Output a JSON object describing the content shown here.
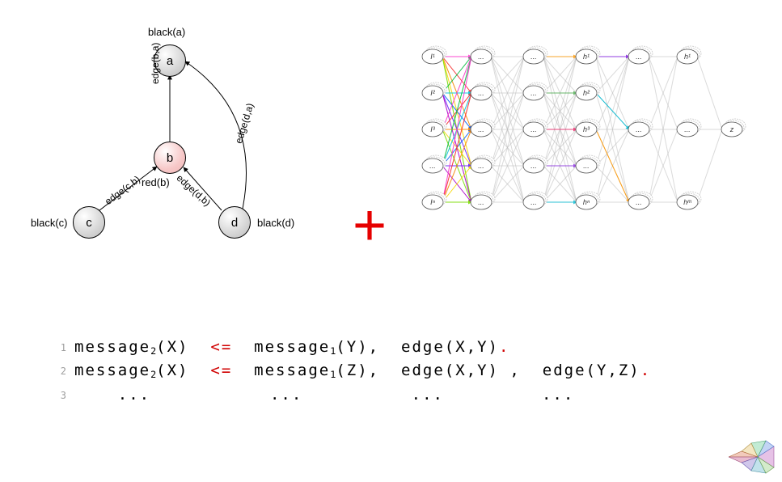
{
  "graph": {
    "nodes": {
      "a": {
        "label": "a",
        "attr": "black(a)"
      },
      "b": {
        "label": "b",
        "attr": "red(b)"
      },
      "c": {
        "label": "c",
        "attr": "black(c)"
      },
      "d": {
        "label": "d",
        "attr": "black(d)"
      }
    },
    "edges": {
      "ba": "edge(b,a)",
      "da": "edge(d,a)",
      "cb": "edge(c,b)",
      "db": "edge(d,b)"
    }
  },
  "nn": {
    "layer1": [
      "I¹",
      "I²",
      "I³",
      "...",
      "Iⁿ"
    ],
    "layer2": [
      "...",
      "...",
      "...",
      "...",
      "..."
    ],
    "layer3": [
      "...",
      "...",
      "...",
      "...",
      "..."
    ],
    "layer4": [
      "h¹",
      "h²",
      "h³",
      "...",
      "hⁿ"
    ],
    "layer5": [
      "...",
      "...",
      "..."
    ],
    "layer6": [
      "h¹",
      "...",
      "hᵐ"
    ],
    "layer7": [
      "z"
    ]
  },
  "plus": "+",
  "code": {
    "lineno1": "1",
    "lineno2": "2",
    "lineno3": "3",
    "msg2": "message",
    "sub2": "2",
    "msg1": "message",
    "sub1": "1",
    "op": "<=",
    "dot": ".",
    "X": "(X)",
    "Y": "(Y)",
    "Z": "(Z)",
    "edgeXY": "edge(X,Y)",
    "edgeYZ": "edge(Y,Z)",
    "comma": ",",
    "ell": "..."
  }
}
